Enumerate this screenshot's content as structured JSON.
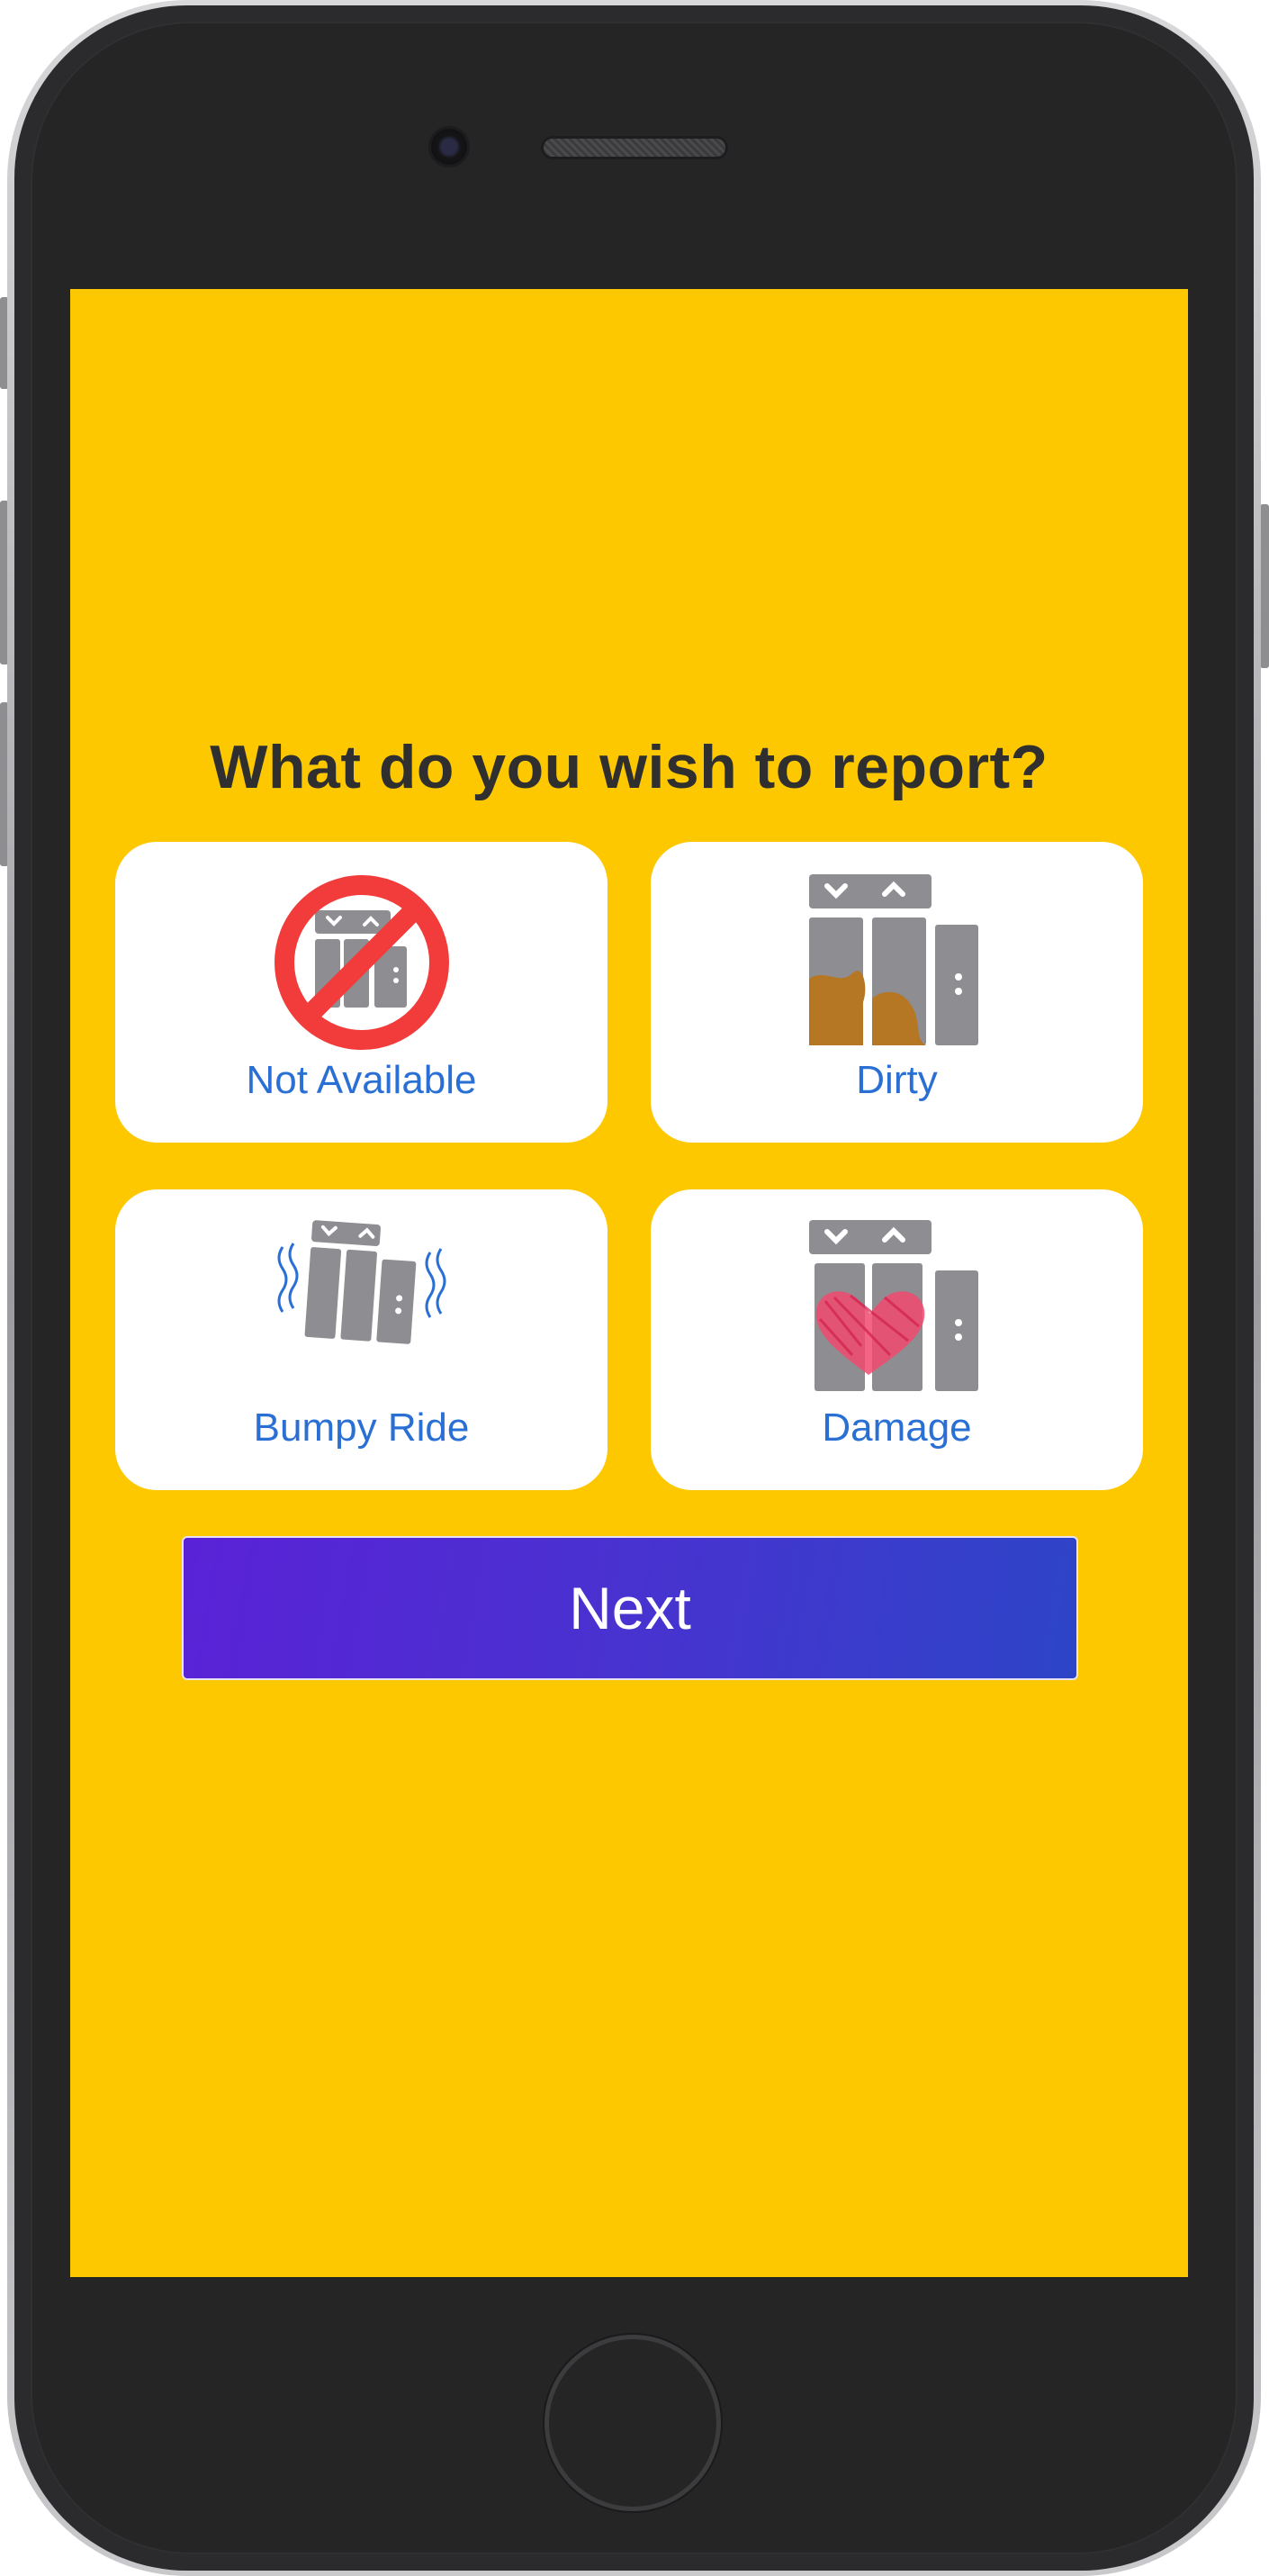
{
  "screen": {
    "question": "What do you wish to report?",
    "background_color": "#fdc800"
  },
  "options": [
    {
      "label": "Not Available",
      "icon": "elevator-unavailable-icon"
    },
    {
      "label": "Dirty",
      "icon": "elevator-dirty-icon"
    },
    {
      "label": "Bumpy Ride",
      "icon": "elevator-bumpy-icon"
    },
    {
      "label": "Damage",
      "icon": "elevator-damage-icon"
    }
  ],
  "next_button": {
    "label": "Next",
    "gradient_start": "#5a22d6",
    "gradient_end": "#2d45c7"
  },
  "colors": {
    "label_text": "#2a6fd4",
    "question_text": "#2f2f2f",
    "icon_gray": "#8e8d92",
    "prohibit_red": "#f23b3b",
    "dirt_brown": "#b57723",
    "heart_pink": "#f2496e"
  }
}
